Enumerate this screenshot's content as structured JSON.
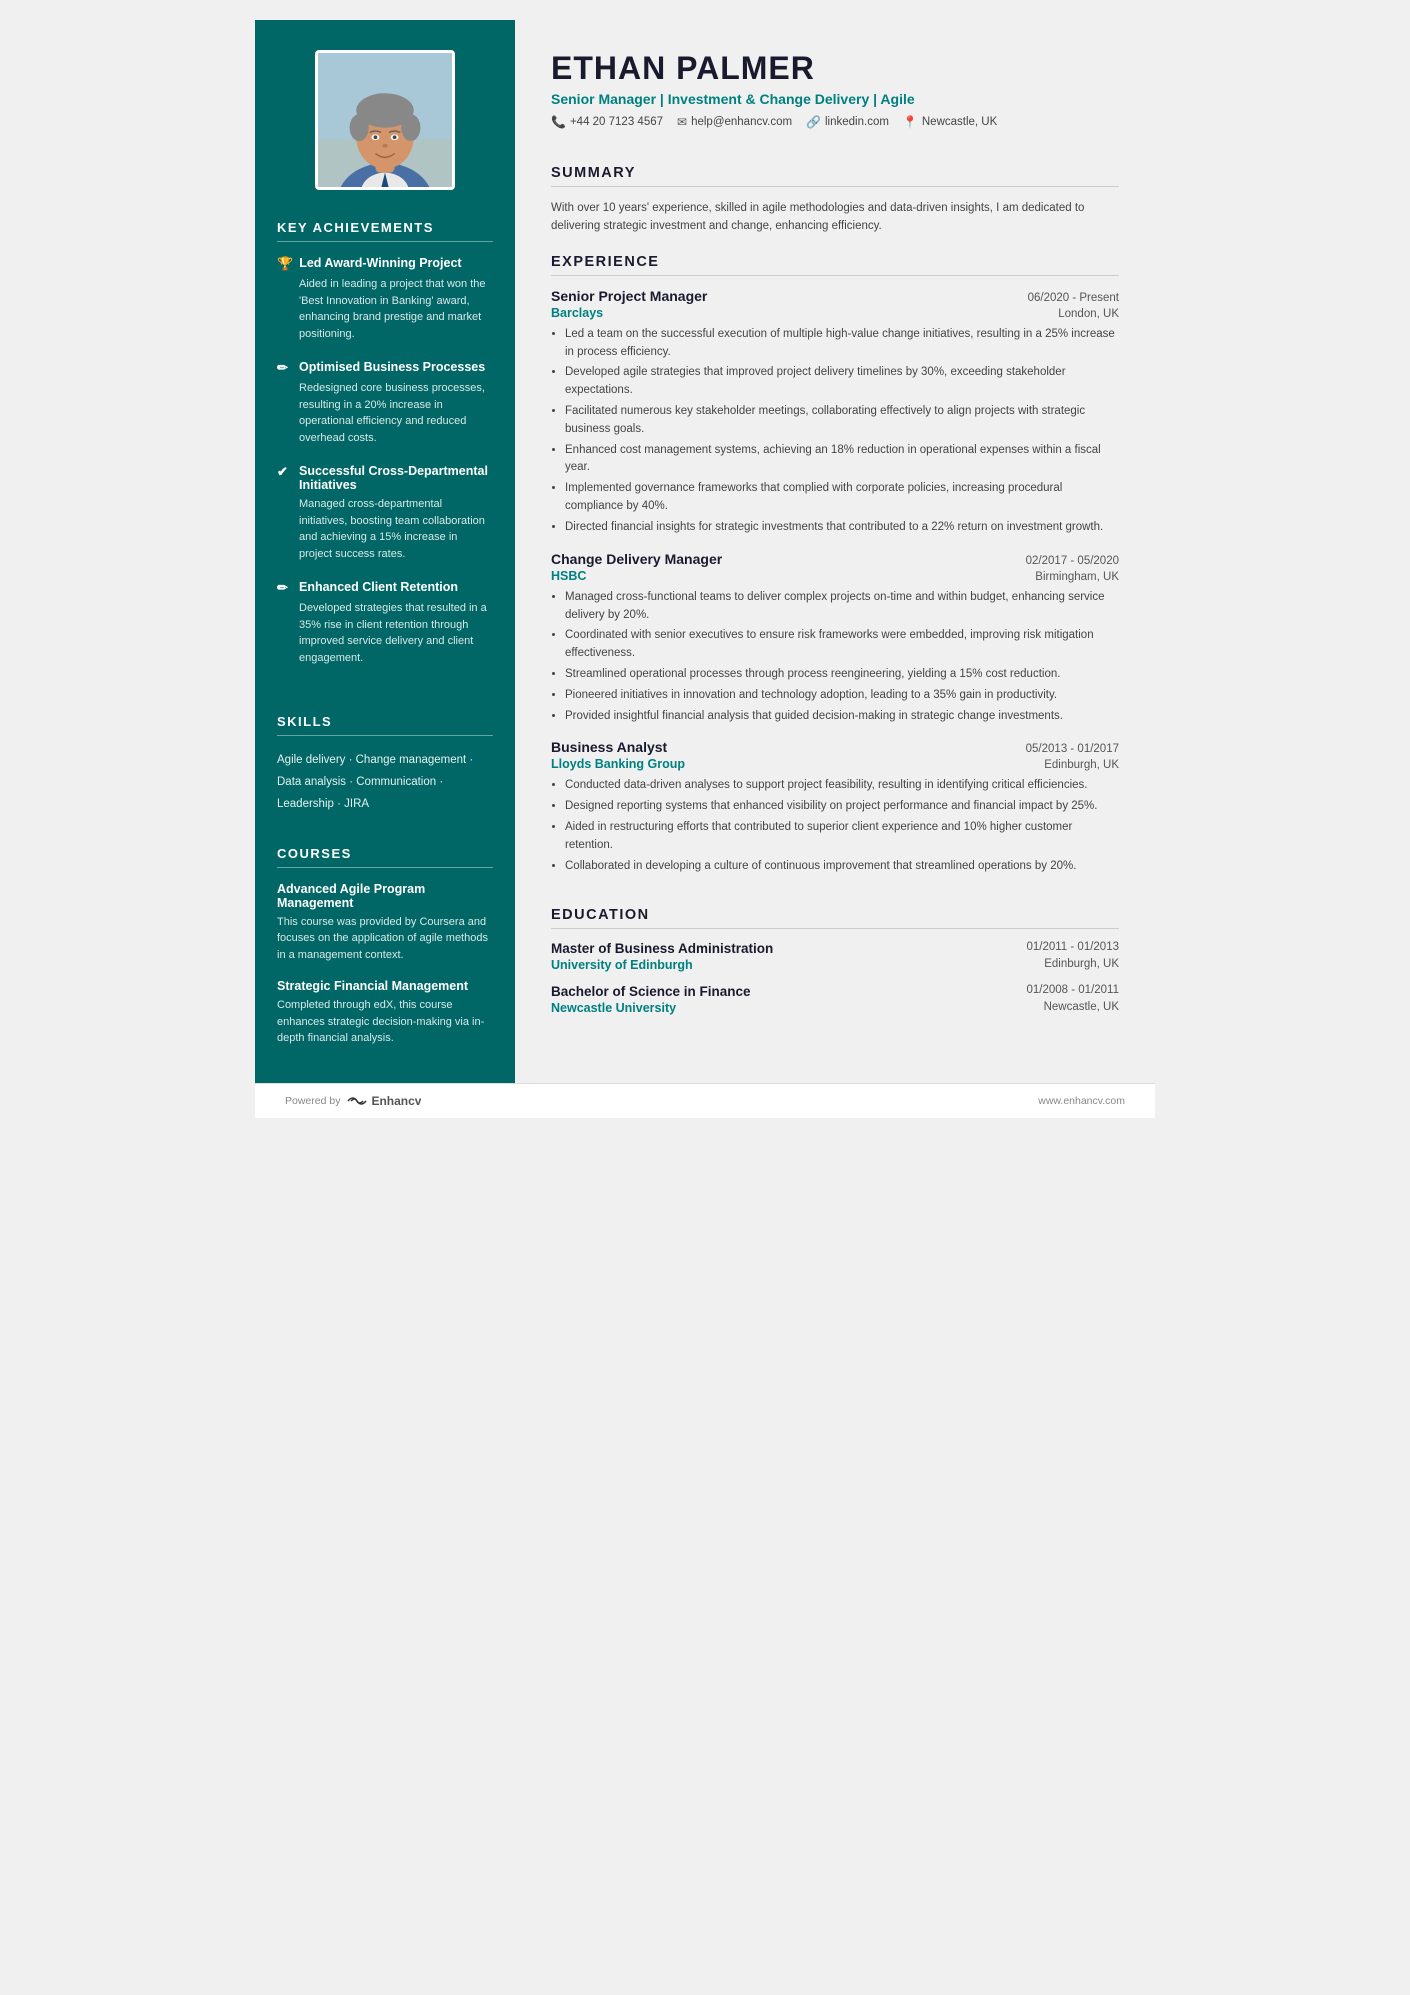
{
  "header": {
    "name": "ETHAN PALMER",
    "subtitle": "Senior Manager | Investment & Change Delivery | Agile",
    "phone": "+44 20 7123 4567",
    "email": "help@enhancv.com",
    "linkedin": "linkedin.com",
    "location": "Newcastle, UK"
  },
  "summary": {
    "title": "SUMMARY",
    "text": "With over 10 years' experience, skilled in agile methodologies and data-driven insights, I am dedicated to delivering strategic investment and change, enhancing efficiency."
  },
  "achievements": {
    "title": "KEY ACHIEVEMENTS",
    "items": [
      {
        "icon": "🏆",
        "title": "Led Award-Winning Project",
        "desc": "Aided in leading a project that won the 'Best Innovation in Banking' award, enhancing brand prestige and market positioning."
      },
      {
        "icon": "✏",
        "title": "Optimised Business Processes",
        "desc": "Redesigned core business processes, resulting in a 20% increase in operational efficiency and reduced overhead costs."
      },
      {
        "icon": "✔",
        "title": "Successful Cross-Departmental Initiatives",
        "desc": "Managed cross-departmental initiatives, boosting team collaboration and achieving a 15% increase in project success rates."
      },
      {
        "icon": "✏",
        "title": "Enhanced Client Retention",
        "desc": "Developed strategies that resulted in a 35% rise in client retention through improved service delivery and client engagement."
      }
    ]
  },
  "skills": {
    "title": "SKILLS",
    "lines": [
      "Agile delivery · Change management ·",
      "Data analysis · Communication ·",
      "Leadership · JIRA"
    ]
  },
  "courses": {
    "title": "COURSES",
    "items": [
      {
        "title": "Advanced Agile Program Management",
        "desc": "This course was provided by Coursera and focuses on the application of agile methods in a management context."
      },
      {
        "title": "Strategic Financial Management",
        "desc": "Completed through edX, this course enhances strategic decision-making via in-depth financial analysis."
      }
    ]
  },
  "experience": {
    "title": "EXPERIENCE",
    "jobs": [
      {
        "title": "Senior Project Manager",
        "dates": "06/2020 - Present",
        "company": "Barclays",
        "location": "London, UK",
        "bullets": [
          "Led a team on the successful execution of multiple high-value change initiatives, resulting in a 25% increase in process efficiency.",
          "Developed agile strategies that improved project delivery timelines by 30%, exceeding stakeholder expectations.",
          "Facilitated numerous key stakeholder meetings, collaborating effectively to align projects with strategic business goals.",
          "Enhanced cost management systems, achieving an 18% reduction in operational expenses within a fiscal year.",
          "Implemented governance frameworks that complied with corporate policies, increasing procedural compliance by 40%.",
          "Directed financial insights for strategic investments that contributed to a 22% return on investment growth."
        ]
      },
      {
        "title": "Change Delivery Manager",
        "dates": "02/2017 - 05/2020",
        "company": "HSBC",
        "location": "Birmingham, UK",
        "bullets": [
          "Managed cross-functional teams to deliver complex projects on-time and within budget, enhancing service delivery by 20%.",
          "Coordinated with senior executives to ensure risk frameworks were embedded, improving risk mitigation effectiveness.",
          "Streamlined operational processes through process reengineering, yielding a 15% cost reduction.",
          "Pioneered initiatives in innovation and technology adoption, leading to a 35% gain in productivity.",
          "Provided insightful financial analysis that guided decision-making in strategic change investments."
        ]
      },
      {
        "title": "Business Analyst",
        "dates": "05/2013 - 01/2017",
        "company": "Lloyds Banking Group",
        "location": "Edinburgh, UK",
        "bullets": [
          "Conducted data-driven analyses to support project feasibility, resulting in identifying critical efficiencies.",
          "Designed reporting systems that enhanced visibility on project performance and financial impact by 25%.",
          "Aided in restructuring efforts that contributed to superior client experience and 10% higher customer retention.",
          "Collaborated in developing a culture of continuous improvement that streamlined operations by 20%."
        ]
      }
    ]
  },
  "education": {
    "title": "EDUCATION",
    "items": [
      {
        "degree": "Master of Business Administration",
        "dates": "01/2011 - 01/2013",
        "school": "University of Edinburgh",
        "location": "Edinburgh, UK"
      },
      {
        "degree": "Bachelor of Science in Finance",
        "dates": "01/2008 - 01/2011",
        "school": "Newcastle University",
        "location": "Newcastle, UK"
      }
    ]
  },
  "footer": {
    "powered_by": "Powered by",
    "brand": "Enhancv",
    "website": "www.enhancv.com"
  }
}
